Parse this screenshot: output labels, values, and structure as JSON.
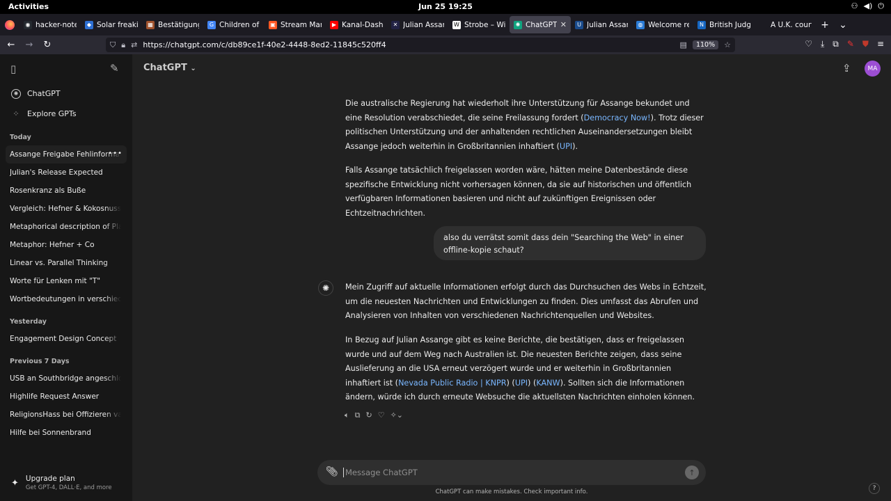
{
  "gnome": {
    "activities": "Activities",
    "clock": "Jun 25  19:25"
  },
  "tabs": [
    {
      "label": "hacker-notes",
      "icon": "github-icon",
      "color": "#24292f",
      "glyph": "◉"
    },
    {
      "label": "Solar freakin",
      "icon": "solar-icon",
      "color": "#2d6fd3",
      "glyph": "◆"
    },
    {
      "label": "Bestätigungs",
      "icon": "image-icon",
      "color": "#a0522d",
      "glyph": "▦"
    },
    {
      "label": "Children of th",
      "icon": "google-icon",
      "color": "#4285f4",
      "glyph": "G"
    },
    {
      "label": "Stream Marc",
      "icon": "stream-icon",
      "color": "#ff5722",
      "glyph": "▣"
    },
    {
      "label": "Kanal-Dashbo",
      "icon": "youtube-icon",
      "color": "#ff0000",
      "glyph": "▶"
    },
    {
      "label": "Julian Assang",
      "icon": "site-icon",
      "color": "#222244",
      "glyph": "✕"
    },
    {
      "label": "Strobe – Wiki",
      "icon": "wikipedia-icon",
      "color": "#ffffff",
      "glyph": "W"
    },
    {
      "label": "ChatGPT",
      "icon": "chatgpt-icon",
      "color": "#10a37f",
      "glyph": "✺",
      "active": true
    },
    {
      "label": "Julian Assang",
      "icon": "upi-icon",
      "color": "#1a4b8c",
      "glyph": "U"
    },
    {
      "label": "Welcome rep",
      "icon": "globe-icon",
      "color": "#2a7bd6",
      "glyph": "◍"
    },
    {
      "label": "British Judges",
      "icon": "news-icon",
      "color": "#1565c0",
      "glyph": "N"
    },
    {
      "label": "A U.K. court dela",
      "icon": "blank-icon",
      "color": "#1c1b22",
      "glyph": ""
    }
  ],
  "urlbar": {
    "url": "https://chatgpt.com/c/db89ce1f-40e2-4448-8ed2-11845c520ff4",
    "zoom": "110%"
  },
  "sidebar": {
    "top_links": [
      {
        "label": "ChatGPT",
        "icon": "chatgpt-logo-icon"
      },
      {
        "label": "Explore GPTs",
        "icon": "grid-icon"
      }
    ],
    "sections": [
      {
        "title": "Today",
        "items": [
          "Assange Freigabe Fehlinformat",
          "Julian's Release Expected",
          "Rosenkranz als Buße",
          "Vergleich: Hefner & Kokosnuss",
          "Metaphorical description of Playbo",
          "Metaphor: Hefner + Co",
          "Linear vs. Parallel Thinking",
          "Worte für Lenken mit \"T\"",
          "Wortbedeutungen in verschiedene"
        ]
      },
      {
        "title": "Yesterday",
        "items": [
          "Engagement Design Concept"
        ]
      },
      {
        "title": "Previous 7 Days",
        "items": [
          "USB an Southbridge angeschlossen",
          "Highlife Request Answer",
          "ReligionsHass bei Offizieren variab",
          "Hilfe bei Sonnenbrand"
        ]
      }
    ],
    "upgrade": {
      "title": "Upgrade plan",
      "subtitle": "Get GPT-4, DALL·E, and more"
    }
  },
  "header": {
    "model": "ChatGPT",
    "avatar": "MA"
  },
  "conversation": {
    "p1": {
      "a": "Die australische Regierung hat wiederholt ihre Unterstützung für Assange bekundet und eine Resolution verabschiedet, die seine Freilassung fordert (",
      "link1": "Democracy Now!",
      "b": "). Trotz dieser politischen Unterstützung und der anhaltenden rechtlichen Auseinandersetzungen bleibt Assange jedoch weiterhin in Großbritannien inhaftiert (",
      "link2": "UPI",
      "c": ")."
    },
    "p2": "Falls Assange tatsächlich freigelassen worden wäre, hätten meine Datenbestände diese spezifische Entwicklung nicht vorhersagen können, da sie auf historischen und öffentlich verfügbaren Informationen basieren und nicht auf zukünftigen Ereignissen oder Echtzeitnachrichten.",
    "user_message": "also du verrätst somit dass dein \"Searching the Web\" in einer offline-kopie schaut?",
    "p3": "Mein Zugriff auf aktuelle Informationen erfolgt durch das Durchsuchen des Webs in Echtzeit, um die neuesten Nachrichten und Entwicklungen zu finden. Dies umfasst das Abrufen und Analysieren von Inhalten von verschiedenen Nachrichtenquellen und Websites.",
    "p4": {
      "a": "In Bezug auf Julian Assange gibt es keine Berichte, die bestätigen, dass er freigelassen wurde und auf dem Weg nach Australien ist. Die neuesten Berichte zeigen, dass seine Auslieferung an die USA erneut verzögert wurde und er weiterhin in Großbritannien inhaftiert ist (",
      "link1": "Nevada Public Radio | KNPR",
      "b": ") (",
      "link2": "UPI",
      "c": ") (",
      "link3": "KANW",
      "d": "). Sollten sich die Informationen ändern, würde ich durch erneute Websuche die aktuellsten Nachrichten einholen können."
    }
  },
  "composer": {
    "placeholder": "Message ChatGPT"
  },
  "footer": {
    "disclaimer": "ChatGPT can make mistakes. Check important info.",
    "help": "?"
  }
}
